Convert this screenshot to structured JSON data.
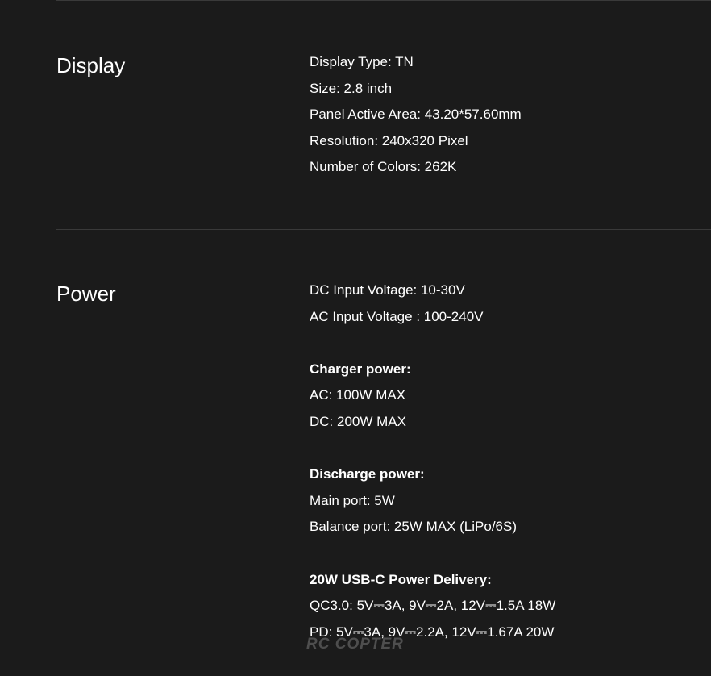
{
  "display": {
    "title": "Display",
    "specs": [
      "Display Type: TN",
      "Size: 2.8 inch",
      "Panel Active Area: 43.20*57.60mm",
      "Resolution: 240x320 Pixel",
      "Number of Colors: 262K"
    ]
  },
  "power": {
    "title": "Power",
    "input": [
      "DC Input Voltage: 10-30V",
      "AC Input Voltage : 100-240V"
    ],
    "charger": {
      "heading": "Charger power:",
      "items": [
        "AC: 100W MAX",
        "DC: 200W MAX"
      ]
    },
    "discharge": {
      "heading": "Discharge power:",
      "items": [
        "Main port: 5W",
        "Balance port: 25W MAX (LiPo/6S)"
      ]
    },
    "usb_c": {
      "heading": "20W USB-C Power Delivery:",
      "items": [
        "QC3.0: 5V⎓3A, 9V⎓2A, 12V⎓1.5A 18W",
        "PD: 5V⎓3A, 9V⎓2.2A, 12V⎓1.67A 20W"
      ]
    }
  },
  "watermark": {
    "text": "RC COPTER"
  },
  "colors": {
    "background": "#1b1b1b",
    "text": "#ffffff",
    "divider": "#3a3a3a"
  }
}
